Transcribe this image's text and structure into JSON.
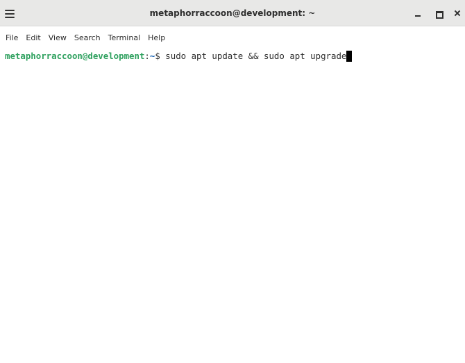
{
  "window": {
    "title": "metaphorraccoon@development: ~"
  },
  "menubar": {
    "items": [
      "File",
      "Edit",
      "View",
      "Search",
      "Terminal",
      "Help"
    ]
  },
  "terminal": {
    "prompt_user_host": "metaphorraccoon@development",
    "prompt_sep": ":",
    "prompt_path": "~",
    "prompt_symbol": "$ ",
    "command": "sudo apt update && sudo apt upgrade"
  },
  "colors": {
    "prompt_user": "#2fa15f",
    "prompt_path": "#1b64b5",
    "titlebar_bg": "#e8e8e7",
    "terminal_bg": "#ffffff",
    "cursor": "#000000"
  }
}
